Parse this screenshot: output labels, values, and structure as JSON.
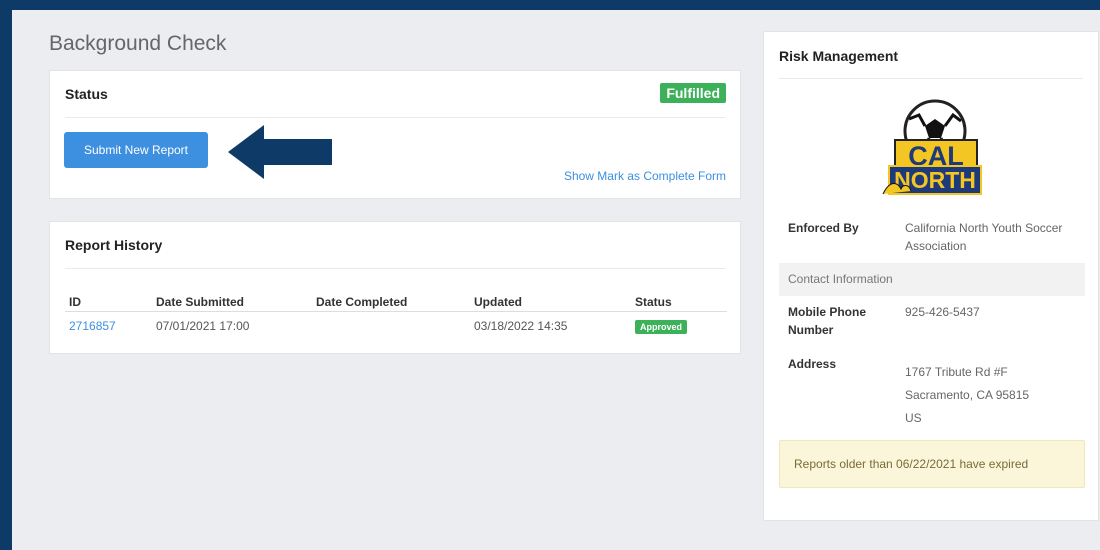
{
  "page": {
    "title": "Background Check"
  },
  "status_card": {
    "title": "Status",
    "badge": "Fulfilled",
    "submit_label": "Submit New Report",
    "complete_link": "Show Mark as Complete Form"
  },
  "history": {
    "title": "Report History",
    "columns": [
      "ID",
      "Date Submitted",
      "Date Completed",
      "Updated",
      "Status"
    ],
    "rows": [
      {
        "id": "2716857",
        "submitted": "07/01/2021 17:00",
        "completed": "",
        "updated": "03/18/2022 14:35",
        "status": "Approved"
      }
    ]
  },
  "risk": {
    "title": "Risk Management",
    "logo_text": "CAL NORTH",
    "enforced_label": "Enforced By",
    "enforced_value": "California North Youth Soccer Association",
    "contact_header": "Contact Information",
    "phone_label": "Mobile Phone Number",
    "phone_value": "925-426-5437",
    "address_label": "Address",
    "address_line1": "1767 Tribute Rd #F",
    "address_line2": "Sacramento, CA 95815",
    "address_line3": "US",
    "expired_note": "Reports older than 06/22/2021 have expired"
  },
  "colors": {
    "accent": "#3d8fe0",
    "success": "#3cb15a",
    "frame": "#0d3a66",
    "arrow": "#0d3a66"
  },
  "icons": {
    "arrow": "left-arrow-icon"
  }
}
